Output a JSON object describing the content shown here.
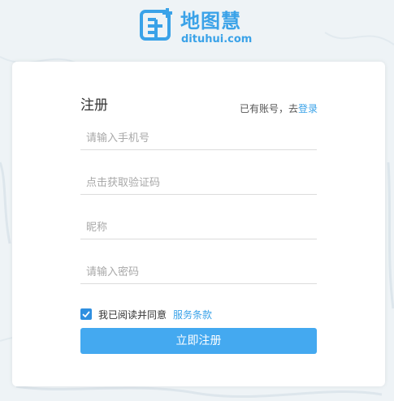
{
  "brand": {
    "name": "地图慧",
    "domain": "dituhui.com",
    "accent_color": "#3aa2e8",
    "logo_icon": "map-grid-plus-icon"
  },
  "form": {
    "title": "注册",
    "have_account_text": "已有账号，去",
    "login_link": "登录",
    "fields": [
      {
        "name": "phone",
        "value": "",
        "placeholder": "请输入手机号"
      },
      {
        "name": "verification-code",
        "value": "",
        "placeholder": "点击获取验证码"
      },
      {
        "name": "nickname",
        "value": "",
        "placeholder": "昵称"
      },
      {
        "name": "password",
        "value": "",
        "placeholder": "请输入密码"
      }
    ],
    "agree": {
      "checked": true,
      "text": "我已阅读并同意",
      "link": "服务条款"
    },
    "submit_label": "立即注册",
    "button_color": "#44a9f0"
  }
}
